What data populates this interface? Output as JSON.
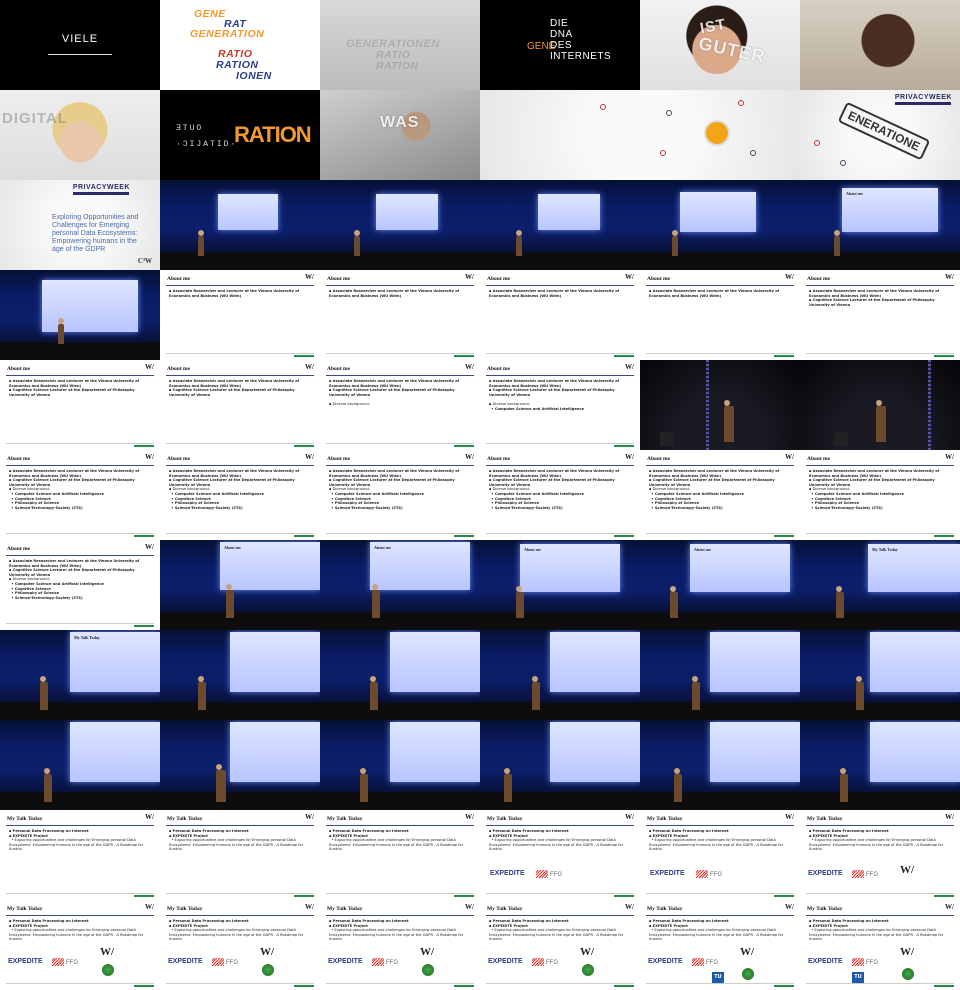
{
  "frames": {
    "viele": "VIELE",
    "gene_words": [
      "GENE",
      "RAT",
      "GENERATION",
      "RATIO",
      "RATION",
      "IONEN"
    ],
    "ghost_words": [
      "GENERATIONEN",
      "RATIO",
      "RATION"
    ],
    "dna_words": [
      "DIE",
      "DNA",
      "DES",
      "INTERNETS"
    ],
    "dna_gene": "GENE",
    "ist_guter": [
      "IST",
      "GUTER"
    ],
    "digital": "DIGITAL",
    "ration": "RATION",
    "was_fair": "WAS",
    "privacy_logo": "PRIVACYWEEK",
    "stamp": "ENERATIONE",
    "ccc_logo": "C³W",
    "pw_text": "Exploring Opportunities and Challenges for Emerging personal Data Ecosystems: Empowering humans in the age of the GDPR"
  },
  "slides": {
    "about_title": "About me",
    "talk_title": "My Talk Today",
    "wu_logo": "W/",
    "about_b1": "Associate Researcher and Lecturer at the Vienna University of Economics and Business (WU Wien)",
    "about_b2": "Cognitive Science Lecturer at the Department of Philosophy University of Vienna",
    "about_bg": "Diverse background:",
    "about_s1": "Computer Science and Artificial Intelligence",
    "about_s2": "Cognitive Science",
    "about_s3": "Philosophy of Science",
    "about_s4": "Science-Technology-Society (STS)",
    "talk_b1": "Personal Data Processing on Internet",
    "talk_b2": "EXPEDITE Project",
    "talk_s1": "Exploring opportunities and challenges for Emerging personal DatA Ecosystems: Empowering humans in the age of the GDPR - A Roadmap for Austria",
    "logo_expedite": "EXPEDITE",
    "logo_ffg": "FFG",
    "logo_tu": "TU"
  }
}
